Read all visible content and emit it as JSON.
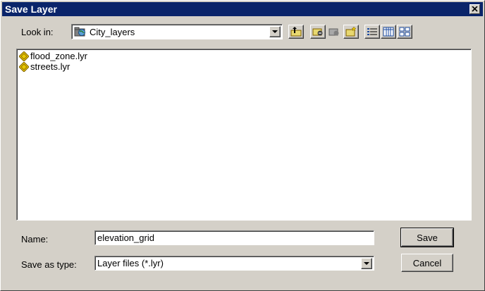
{
  "window": {
    "title": "Save Layer"
  },
  "look_in": {
    "label": "Look in:",
    "value": "City_layers",
    "icon": "folder-globe-icon"
  },
  "toolbar": {
    "buttons": [
      "up-one-level-icon",
      "connect-folder-icon",
      "disconnect-folder-icon",
      "new-folder-icon",
      "list-view-icon",
      "details-view-icon",
      "thumbnails-view-icon"
    ]
  },
  "files": [
    {
      "name": "flood_zone.lyr",
      "icon": "layer-file-icon"
    },
    {
      "name": "streets.lyr",
      "icon": "layer-file-icon"
    }
  ],
  "name_field": {
    "label": "Name:",
    "value": "elevation_grid"
  },
  "type_field": {
    "label": "Save as type:",
    "value": "Layer files (*.lyr)"
  },
  "buttons": {
    "save": "Save",
    "cancel": "Cancel"
  },
  "colors": {
    "titlebar": "#0a246a",
    "face": "#d4d0c8",
    "layer_icon": "#e8c800"
  }
}
